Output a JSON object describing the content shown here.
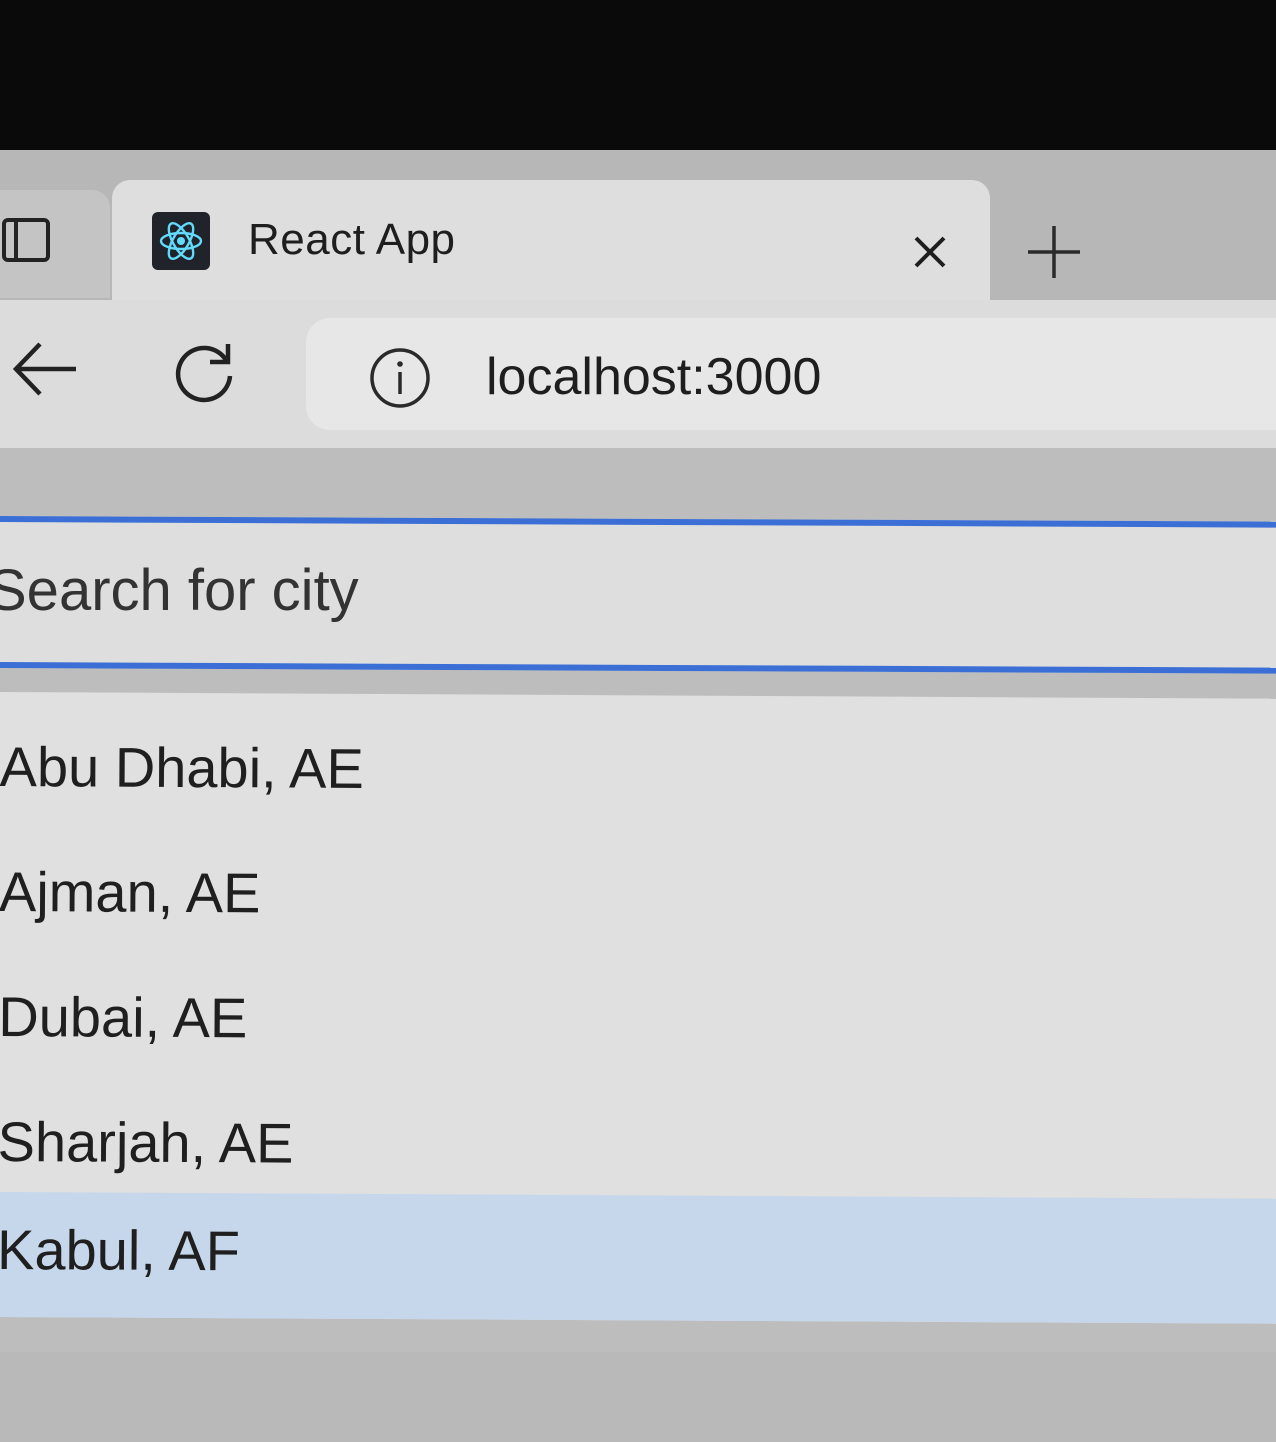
{
  "browser": {
    "tab": {
      "title": "React App",
      "favicon": "react-logo-icon"
    },
    "address_bar": {
      "url": "localhost:3000",
      "security_icon": "info-icon"
    },
    "icons": {
      "tab_actions": "tab-actions-icon",
      "close_tab": "close-icon",
      "new_tab": "plus-icon",
      "back": "back-arrow-icon",
      "reload": "reload-icon"
    }
  },
  "search": {
    "placeholder": "Search for city",
    "value": "",
    "border_color": "#3b6fd6"
  },
  "results": [
    "Abu Dhabi, AE",
    "Ajman, AE",
    "Dubai, AE",
    "Sharjah, AE",
    "Kabul, AF"
  ],
  "highlighted_result": "Kabul, AF",
  "colors": {
    "highlight": "#c6d7ec",
    "accent": "#3b6fd6"
  }
}
